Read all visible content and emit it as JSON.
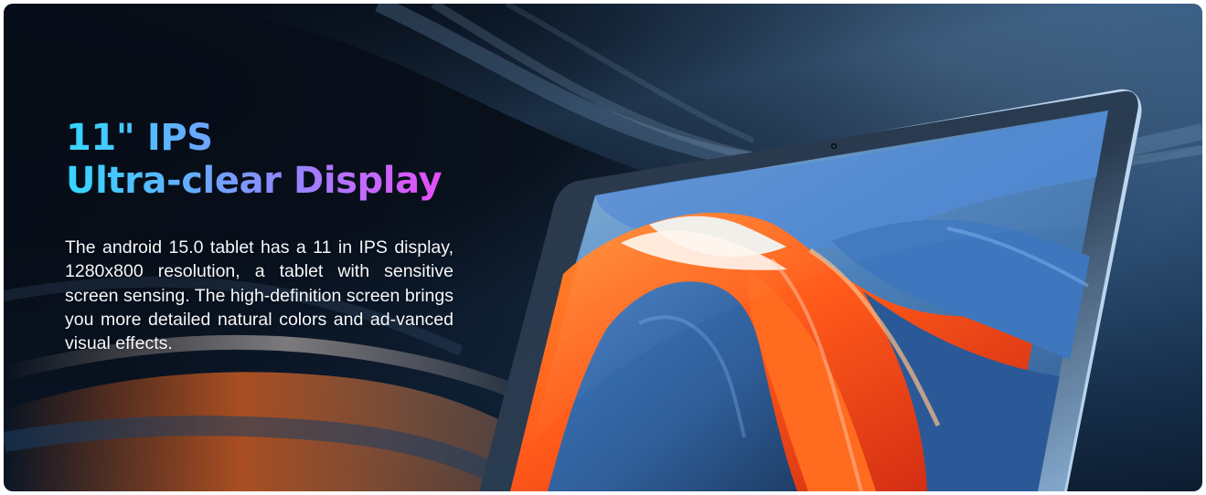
{
  "banner": {
    "headline_line1": "11\" IPS",
    "headline_line2": "Ultra-clear Display",
    "description": "The android 15.0 tablet has a 11 in IPS display, 1280x800 resolution, a tablet with sensitive screen sensing. The high-definition screen brings you more detailed natural colors and ad-vanced visual effects."
  },
  "colors": {
    "headline_gradient_start": "#35d6ff",
    "headline_gradient_end": "#e44ef5",
    "background_dark": "#07101b",
    "background_blue": "#2f5278",
    "screen_orange": "#ff5a1a",
    "screen_blue": "#4d86cf",
    "tablet_frame": "#8fb5d9"
  },
  "icons": {
    "tablet": "tablet-device-icon",
    "camera": "front-camera-icon"
  }
}
